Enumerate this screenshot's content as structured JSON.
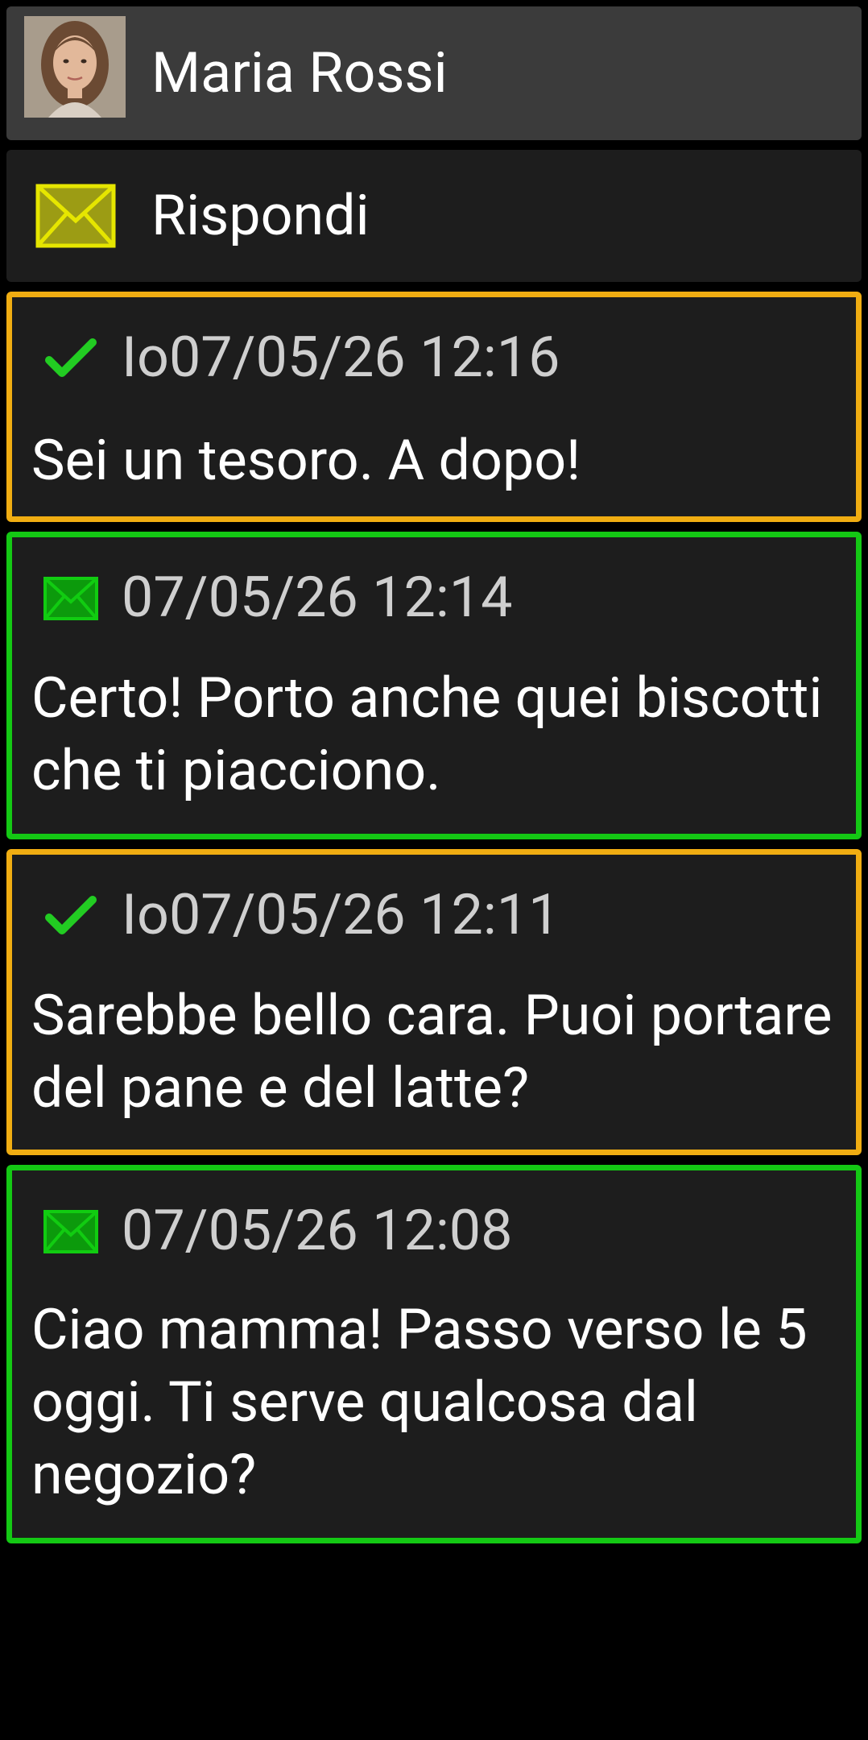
{
  "header": {
    "contact_name": "Maria Rossi",
    "avatar_alt": "Maria Rossi"
  },
  "reply": {
    "label": "Rispondi",
    "icon": "envelope-icon",
    "icon_color": "#e6e600"
  },
  "colors": {
    "sent_border": "#f0ad12",
    "received_border": "#14c814",
    "check_color": "#22cc22",
    "received_icon_color": "#11cc11"
  },
  "messages": [
    {
      "direction": "sent",
      "icon": "checkmark-icon",
      "sender": "Io",
      "timestamp": "07/05/26 12:16",
      "meta": "Io07/05/26 12:16",
      "text": "Sei un tesoro. A dopo!"
    },
    {
      "direction": "received",
      "icon": "envelope-icon",
      "sender": "",
      "timestamp": "07/05/26 12:14",
      "meta": "07/05/26 12:14",
      "text": "Certo! Porto anche quei biscotti che ti piacciono."
    },
    {
      "direction": "sent",
      "icon": "checkmark-icon",
      "sender": "Io",
      "timestamp": "07/05/26 12:11",
      "meta": "Io07/05/26 12:11",
      "text": "Sarebbe bello cara. Puoi portare del pane e del latte?"
    },
    {
      "direction": "received",
      "icon": "envelope-icon",
      "sender": "",
      "timestamp": "07/05/26 12:08",
      "meta": "07/05/26 12:08",
      "text": "Ciao mamma! Passo verso le 5 oggi. Ti serve qualcosa dal negozio?"
    }
  ]
}
